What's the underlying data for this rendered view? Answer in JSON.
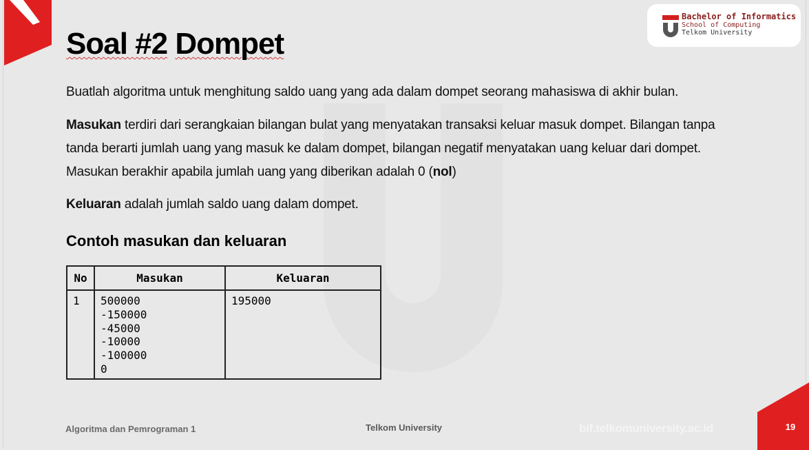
{
  "header": {
    "title_prefix": "Soal #2",
    "title_word": "Dompet"
  },
  "logo": {
    "line1": "Bachelor of Informatics",
    "line2": "School of Computing",
    "line3": "Telkom University"
  },
  "body": {
    "p1": "Buatlah algoritma untuk menghitung saldo uang yang ada dalam dompet seorang mahasiswa di akhir bulan.",
    "p2_bold": "Masukan",
    "p2_text": " terdiri dari serangkaian bilangan bulat yang menyatakan transaksi keluar masuk dompet. Bilangan tanpa tanda berarti jumlah uang yang masuk ke dalam dompet, bilangan negatif menyatakan uang keluar dari dompet. Masukan berakhir apabila jumlah uang yang diberikan adalah 0 (",
    "p2_bold_end": "nol",
    "p2_close": ")",
    "p3_bold": "Keluaran",
    "p3_text": " adalah jumlah saldo uang dalam dompet.",
    "subheading": "Contoh masukan dan keluaran"
  },
  "table": {
    "headers": [
      "No",
      "Masukan",
      "Keluaran"
    ],
    "rows": [
      {
        "no": "1",
        "masukan": [
          "500000",
          "-150000",
          "-45000",
          "-10000",
          "-100000",
          "0"
        ],
        "keluaran": "195000"
      }
    ]
  },
  "footer": {
    "left": "Algoritma dan Pemrograman 1",
    "center": "Telkom University",
    "url": "bif.telkomuniversity.ac.id",
    "page": "19"
  },
  "colors": {
    "accent_red": "#e02020",
    "background": "#e8e8e8"
  }
}
